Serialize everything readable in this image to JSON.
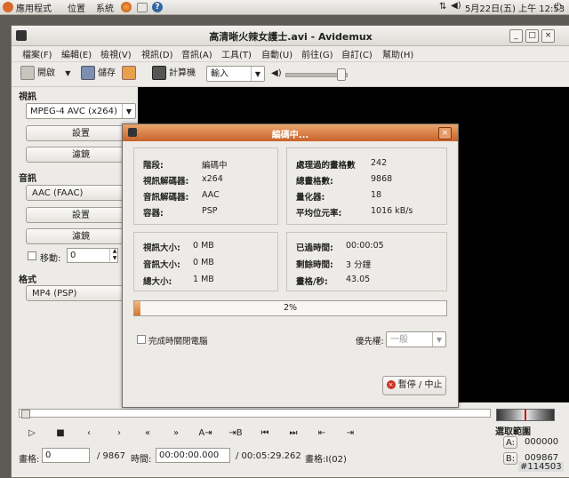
{
  "top_panel": {
    "apps": "應用程式",
    "places": "位置",
    "system": "系統",
    "clock": "5月22日(五) 上午 12:53"
  },
  "window": {
    "title": "高清晰火辣女護士.avi - Avidemux",
    "menu": [
      "檔案(F)",
      "編輯(E)",
      "檢視(V)",
      "視訊(D)",
      "音訊(A)",
      "工具(T)",
      "自動(U)",
      "前往(G)",
      "自訂(C)",
      "幫助(H)"
    ],
    "toolbar": {
      "open": "開啟",
      "save": "儲存",
      "calculator": "計算機",
      "input_combo": "輸入"
    }
  },
  "sidebar": {
    "video_label": "視訊",
    "video_codec": "MPEG-4 AVC (x264)",
    "video_config": "設置",
    "video_filters": "濾鏡",
    "audio_label": "音訊",
    "audio_codec": "AAC (FAAC)",
    "audio_config": "設置",
    "audio_filters": "濾鏡",
    "shift_label": "移動:",
    "shift_value": "0",
    "format_label": "格式",
    "format_value": "MP4 (PSP)"
  },
  "dialog": {
    "title": "編碼中...",
    "phase_k": "階段:",
    "phase_v": "編碼中",
    "vcodec_k": "視訊解碼器:",
    "vcodec_v": "x264",
    "acodec_k": "音訊解碼器:",
    "acodec_v": "AAC",
    "container_k": "容器:",
    "container_v": "PSP",
    "processed_k": "處理過的畫格數",
    "processed_v": "242",
    "total_k": "總畫格數:",
    "total_v": "9868",
    "quant_k": "量化器:",
    "quant_v": "18",
    "bitrate_k": "平均位元率:",
    "bitrate_v": "1016 kB/s",
    "vsize_k": "視訊大小:",
    "vsize_v": "0 MB",
    "asize_k": "音訊大小:",
    "asize_v": "0 MB",
    "tsize_k": "總大小:",
    "tsize_v": "1 MB",
    "elapsed_k": "已過時間:",
    "elapsed_v": "00:00:05",
    "remain_k": "剩餘時間:",
    "remain_v": "3 分鐘",
    "fps_k": "畫格/秒:",
    "fps_v": "43.05",
    "progress_text": "2%",
    "progress_fraction": 0.02,
    "shutdown_label": "完成時關閉電腦",
    "priority_label": "優先權:",
    "priority_value": "一般",
    "pause_button": "暫停 / 中止"
  },
  "bottom": {
    "frame_label": "畫格:",
    "frame_value": "0",
    "frame_total": "/ 9867",
    "time_label": "時間:",
    "time_value": "00:00:00.000",
    "duration": "/ 00:05:29.262",
    "frame_type": "畫格:I(02)",
    "selection_label": "選取範圍",
    "a_label": "A:",
    "a_value": "000000",
    "b_label": "B:",
    "b_value": "009867"
  },
  "watermark": "#114503",
  "colors": {
    "dialog_title": "#c8622a",
    "progress_fill": "#d4752e",
    "video_bg": "#000000"
  }
}
